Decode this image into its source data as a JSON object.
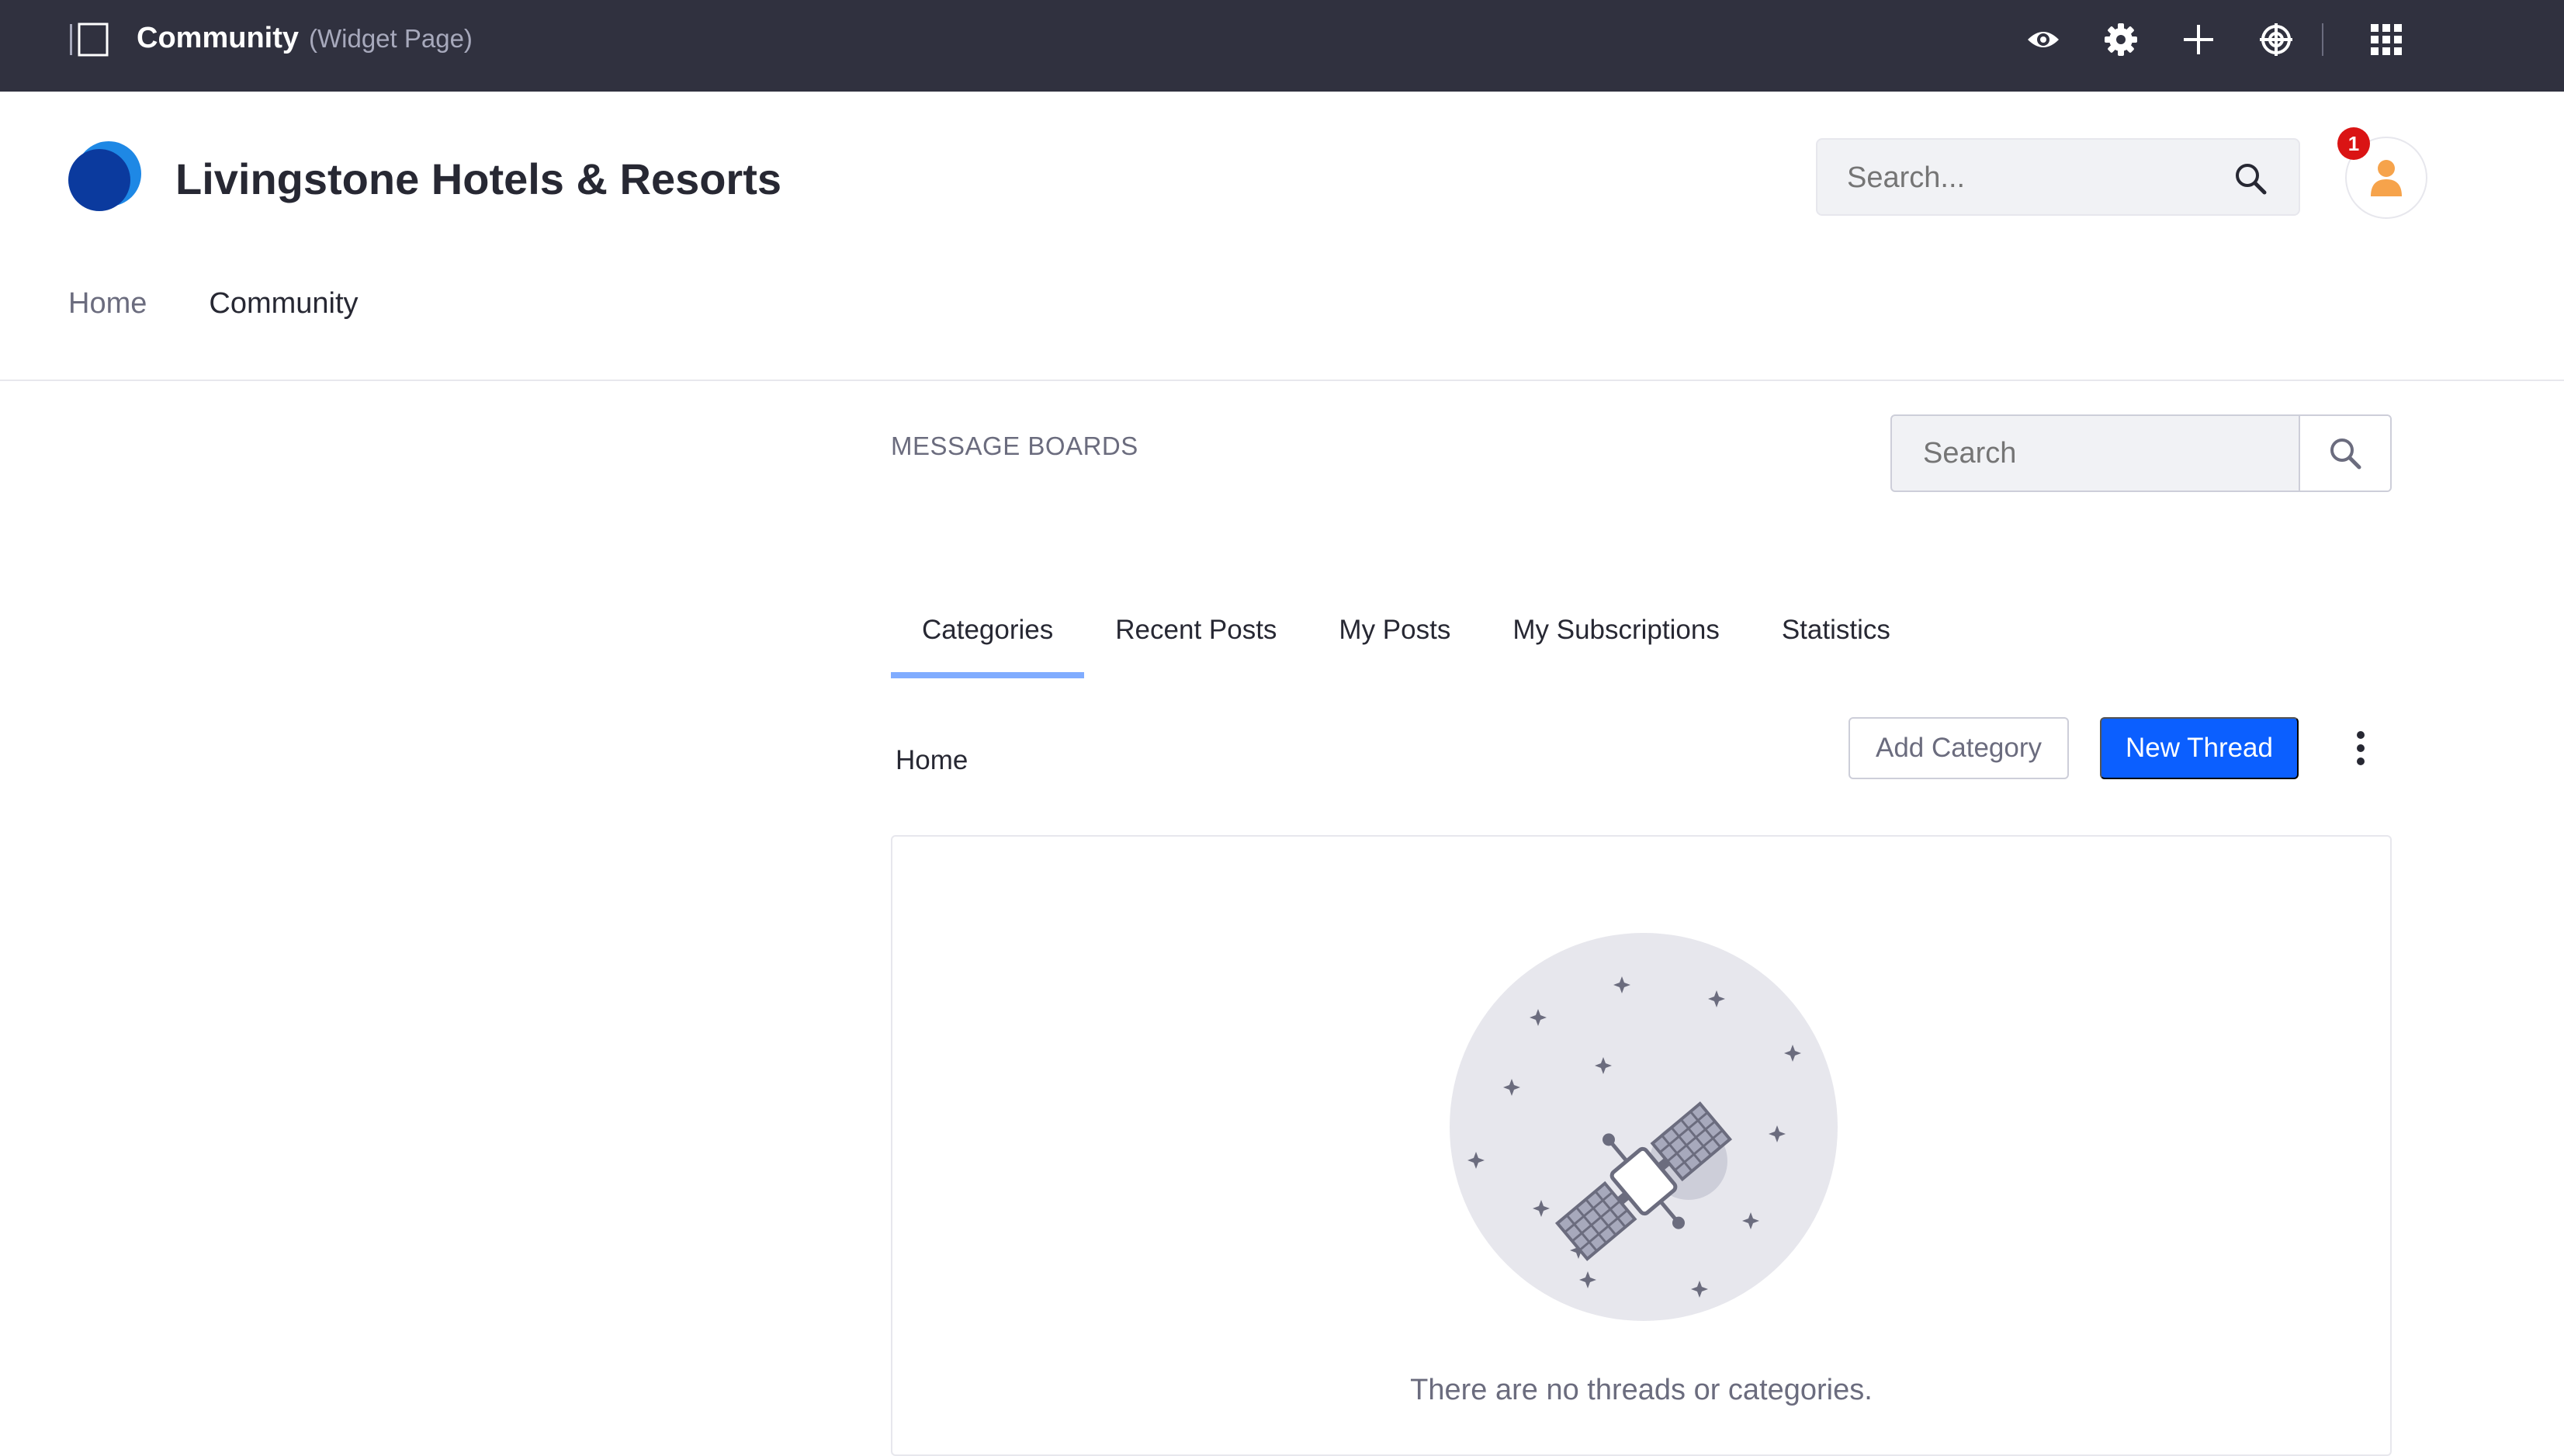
{
  "topbar": {
    "page_title": "Community",
    "page_type": "(Widget Page)",
    "icons": [
      "eye-icon",
      "gear-icon",
      "plus-icon",
      "simulation-icon",
      "apps-grid-icon"
    ]
  },
  "header": {
    "site_name": "Livingstone Hotels & Resorts",
    "search_placeholder": "Search...",
    "notification_count": "1",
    "nav": [
      {
        "label": "Home",
        "active": false
      },
      {
        "label": "Community",
        "active": true
      }
    ]
  },
  "portlet": {
    "title": "MESSAGE BOARDS",
    "search_placeholder": "Search",
    "tabs": [
      {
        "label": "Categories",
        "active": true
      },
      {
        "label": "Recent Posts",
        "active": false
      },
      {
        "label": "My Posts",
        "active": false
      },
      {
        "label": "My Subscriptions",
        "active": false
      },
      {
        "label": "Statistics",
        "active": false
      }
    ],
    "breadcrumb": "Home",
    "add_category_label": "Add Category",
    "new_thread_label": "New Thread",
    "empty_message": "There are no threads or categories."
  },
  "colors": {
    "topbar_bg": "#30313f",
    "primary": "#0b5fff",
    "tab_indicator": "#80acff",
    "badge": "#da1414",
    "logo_dark": "#0b3a9e",
    "logo_light": "#1e88e5"
  }
}
